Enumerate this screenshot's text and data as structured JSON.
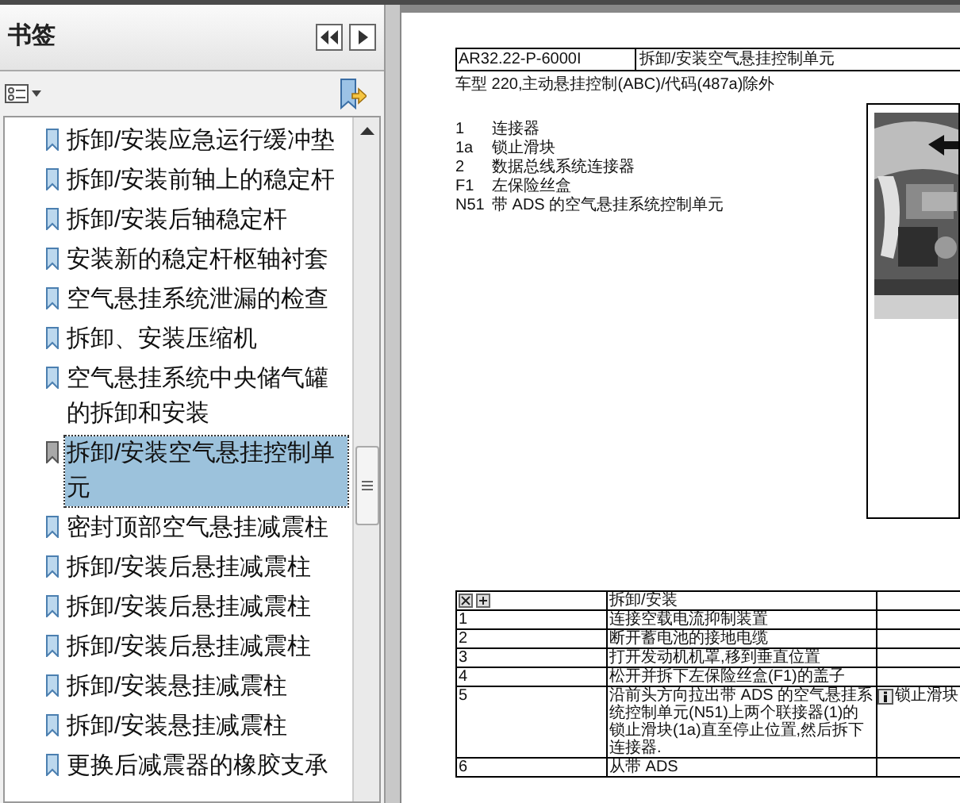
{
  "sidebar": {
    "title": "书签",
    "items": [
      {
        "label": "拆卸/安装应急运行缓冲垫",
        "selected": false
      },
      {
        "label": "拆卸/安装前轴上的稳定杆",
        "selected": false
      },
      {
        "label": "拆卸/安装后轴稳定杆",
        "selected": false
      },
      {
        "label": "安装新的稳定杆枢轴衬套",
        "selected": false
      },
      {
        "label": "空气悬挂系统泄漏的检查",
        "selected": false
      },
      {
        "label": "拆卸、安装压缩机",
        "selected": false
      },
      {
        "label": "空气悬挂系统中央储气罐的拆卸和安装",
        "selected": false
      },
      {
        "label": "拆卸/安装空气悬挂控制单元",
        "selected": true
      },
      {
        "label": "密封顶部空气悬挂减震柱",
        "selected": false
      },
      {
        "label": "拆卸/安装后悬挂减震柱",
        "selected": false
      },
      {
        "label": "拆卸/安装后悬挂减震柱",
        "selected": false
      },
      {
        "label": "拆卸/安装后悬挂减震柱",
        "selected": false
      },
      {
        "label": "拆卸/安装悬挂减震柱",
        "selected": false
      },
      {
        "label": "拆卸/安装悬挂减震柱",
        "selected": false
      },
      {
        "label": "更换后减震器的橡胶支承",
        "selected": false
      }
    ]
  },
  "document": {
    "header": {
      "code": "AR32.22-P-6000I",
      "title": "拆卸/安装空气悬挂控制单元"
    },
    "subtitle": "车型 220,主动悬挂控制(ABC)/代码(487a)除外",
    "legend": [
      {
        "key": "1",
        "text": "连接器"
      },
      {
        "key": "1a",
        "text": "锁止滑块"
      },
      {
        "key": "2",
        "text": "数据总线系统连接器"
      },
      {
        "key": "F1",
        "text": "左保险丝盒"
      },
      {
        "key": "N51",
        "text": "带 ADS 的空气悬挂系统控制单元"
      }
    ],
    "steps_table": {
      "header": "拆卸/安装",
      "rows": [
        {
          "step": "1",
          "text": "连接空载电流抑制装置"
        },
        {
          "step": "2",
          "text": "断开蓄电池的接地电缆"
        },
        {
          "step": "3",
          "text": "打开发动机机罩,移到垂直位置"
        },
        {
          "step": "4",
          "text": "松开并拆下左保险丝盒(F1)的盖子"
        },
        {
          "step": "5",
          "text": "沿前头方向拉出带 ADS 的空气悬挂系统控制单元(N51)上两个联接器(1)的锁止滑块(1a)直至停止位置,然后拆下连接器.",
          "note": "锁止滑块"
        },
        {
          "step": "6",
          "text": "从带 ADS"
        }
      ]
    }
  }
}
